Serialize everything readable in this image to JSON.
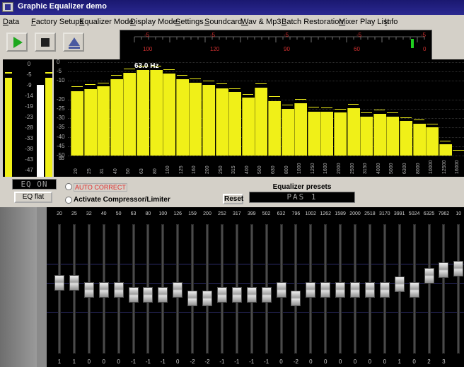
{
  "window": {
    "title": "Graphic Equalizer demo"
  },
  "menu": [
    "Data",
    "Factory Setups",
    "Equalizer Mode",
    "Display Mode",
    "Settings",
    "Soundcard",
    "Wav & Mp3",
    "Batch Restoration",
    "Mixer Play List",
    "Info"
  ],
  "toolbar": {
    "play_icon": "play-icon",
    "stop_icon": "stop-icon",
    "eject_icon": "eject-icon"
  },
  "level_meter": {
    "labels": [
      "100",
      "120",
      "90",
      "60",
      "0"
    ],
    "top_labels": [
      "-5",
      "-5",
      "-5",
      "-5",
      "-5"
    ]
  },
  "vu_scale": [
    "0",
    "-5",
    "-9",
    "-14",
    "-19",
    "-23",
    "-28",
    "-33",
    "-38",
    "-43",
    "-47"
  ],
  "spectrum": {
    "peak_label": "63.0 Hz",
    "db_label": "db",
    "y_labels": [
      "0",
      "-5",
      "-10",
      "-20",
      "-25",
      "-30",
      "-35",
      "-40",
      "-45",
      "-50"
    ],
    "x_labels": [
      "20",
      "25",
      "31",
      "40",
      "50",
      "63",
      "80",
      "100",
      "125",
      "160",
      "200",
      "250",
      "315",
      "400",
      "500",
      "630",
      "800",
      "1000",
      "1250",
      "1600",
      "2000",
      "2500",
      "3150",
      "4000",
      "5000",
      "6300",
      "8000",
      "10000",
      "12500",
      "16000"
    ]
  },
  "controls": {
    "eq_on": "EQ ON",
    "eq_flat": "EQ flat",
    "auto_correct": "AUTO CORRECT",
    "compressor": "Activate Compressor/Limiter",
    "reset": "Reset",
    "presets_title": "Equalizer presets",
    "preset_value": "PAS 1"
  },
  "equalizer": {
    "frequencies": [
      "20",
      "25",
      "32",
      "40",
      "50",
      "63",
      "80",
      "100",
      "126",
      "159",
      "200",
      "252",
      "317",
      "399",
      "502",
      "632",
      "796",
      "1002",
      "1262",
      "1589",
      "2000",
      "2518",
      "3170",
      "3991",
      "5024",
      "6325",
      "7962",
      "10"
    ],
    "gains": [
      "1",
      "1",
      "0",
      "0",
      "0",
      "-1",
      "-1",
      "-1",
      "0",
      "-2",
      "-2",
      "-1",
      "-1",
      "-1",
      "-1",
      "0",
      "-2",
      "0",
      "0",
      "0",
      "0",
      "0",
      "0",
      "1",
      "0",
      "2",
      "3",
      ""
    ]
  },
  "colors": {
    "bar": "#f0f018",
    "background": "#000000",
    "accent_red": "#e03030",
    "meter_green": "#20d020"
  }
}
